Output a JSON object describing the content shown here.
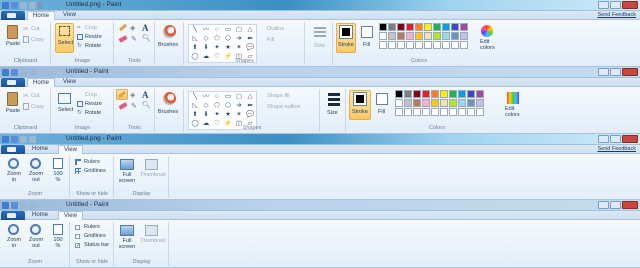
{
  "windows": [
    {
      "title": "Untitled.png - Paint",
      "feedback": "Send Feedback",
      "tabs": [
        "Home",
        "View"
      ],
      "active_tab": "Home"
    },
    {
      "title": "Untitled - Paint",
      "tabs": [
        "Home",
        "View"
      ],
      "active_tab": "Home"
    },
    {
      "title": "Untitled.png - Paint",
      "feedback": "Send Feedback",
      "tabs": [
        "Home",
        "View"
      ],
      "active_tab": "View"
    },
    {
      "title": "Untitled - Paint",
      "tabs": [
        "Home",
        "View"
      ],
      "active_tab": "View"
    }
  ],
  "home8": {
    "clipboard": {
      "paste": "Paste",
      "cut": "Cut",
      "copy": "Copy",
      "group": "Clipboard"
    },
    "image": {
      "select": "Select",
      "crop": "Crop",
      "resize": "Resize",
      "rotate": "Rotate",
      "group": "Image"
    },
    "tools": {
      "group": "Tools"
    },
    "brushes": "Brushes",
    "shapes": {
      "outline": "Outline",
      "fill": "Fill",
      "group": "Shapes"
    },
    "size": "Size",
    "colors": {
      "stroke": "Stroke",
      "fill": "Fill",
      "edit": "Edit colors",
      "group": "Colors"
    }
  },
  "home7": {
    "clipboard": {
      "paste": "Paste",
      "cut": "Cut",
      "copy": "Copy",
      "group": "Clipboard"
    },
    "image": {
      "select": "Select",
      "crop": "Crop",
      "resize": "Resize",
      "rotate": "Rotate",
      "group": "Image"
    },
    "tools": {
      "group": "Tools"
    },
    "brushes": "Brushes",
    "shapes": {
      "fill": "Shape fill",
      "outline": "Shape outline",
      "group": "Shapes"
    },
    "size": "Size",
    "colors": {
      "stroke": "Stroke",
      "fill": "Fill",
      "edit": "Edit colors",
      "group": "Colors"
    }
  },
  "view8": {
    "zoom_in": "Zoom in",
    "zoom_out": "Zoom out",
    "pct": "100 %",
    "zoom_group": "Zoom",
    "rulers": "Rulers",
    "gridlines": "Gridlines",
    "show_group": "Show or hide",
    "full_screen": "Full screen",
    "thumbnail": "Thumbnail",
    "display_group": "Display"
  },
  "view7": {
    "zoom_in": "Zoom in",
    "zoom_out": "Zoom out",
    "pct": "100 %",
    "zoom_group": "Zoom",
    "rulers": "Rulers",
    "gridlines": "Gridlines",
    "status_bar": "Status bar",
    "show_group": "Show or hide",
    "full_screen": "Full screen",
    "thumbnail": "Thumbnail",
    "display_group": "Display"
  },
  "palette": [
    "#000000",
    "#7f7f7f",
    "#880015",
    "#ed1c24",
    "#ff7f27",
    "#fff200",
    "#22b14c",
    "#00a2e8",
    "#3f48cc",
    "#a349a4",
    "#ffffff",
    "#c3c3c3",
    "#b97a57",
    "#ffaec9",
    "#ffc90e",
    "#efe4b0",
    "#b5e61d",
    "#99d9ea",
    "#7092be",
    "#c8bfe7",
    "#ffffff",
    "#ffffff",
    "#ffffff",
    "#ffffff",
    "#ffffff",
    "#ffffff",
    "#ffffff",
    "#ffffff",
    "#ffffff",
    "#ffffff"
  ],
  "shape_glyphs": [
    "╲",
    "〰",
    "○",
    "▭",
    "▢",
    "△",
    "◺",
    "◇",
    "⬠",
    "⬡",
    "➔",
    "⬅",
    "⬆",
    "⬇",
    "✦",
    "★",
    "✶",
    "💬",
    "◯",
    "☁",
    "♡",
    "⚡",
    "◫",
    "▱"
  ]
}
